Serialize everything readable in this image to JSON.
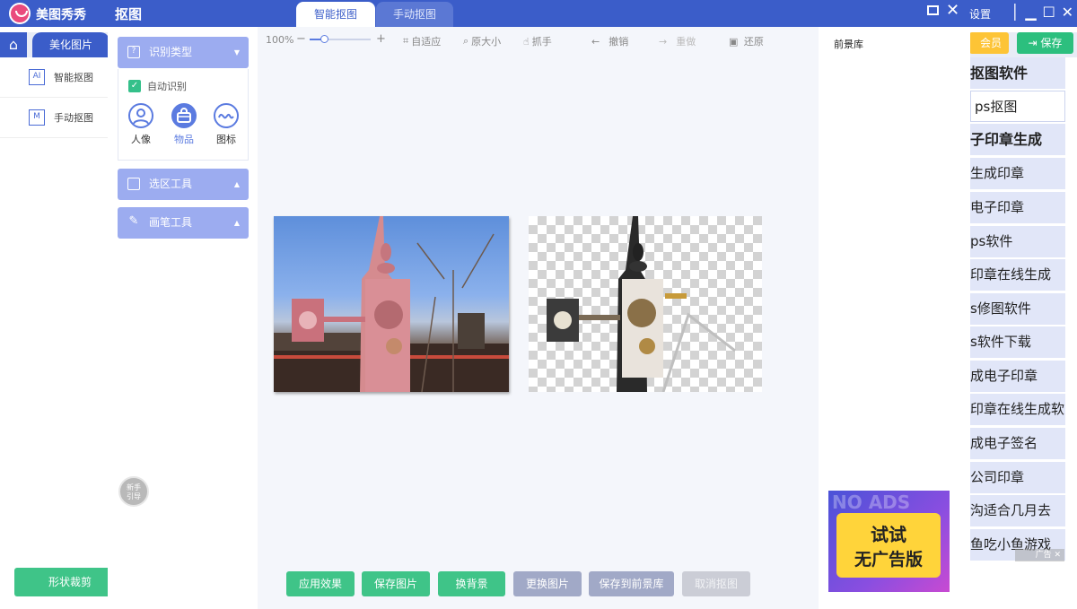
{
  "main_app": {
    "brand": "美图秀秀",
    "settings_label": "设置",
    "home_icon": "home-icon",
    "beautify_tab": "美化图片",
    "vip_label": "会员",
    "save_label": "保存",
    "left_items": [
      {
        "label": "智能抠图",
        "icon": "ai-icon",
        "icon_text": "AI"
      },
      {
        "label": "手动抠图",
        "icon": "manual-cutout-icon",
        "icon_text": "M"
      }
    ],
    "shape_crop_label": "形状裁剪",
    "keywords": [
      "抠图软件",
      "ps抠图",
      "子印章生成",
      "生成印章",
      "电子印章",
      "ps软件",
      "印章在线生成",
      "s修图软件",
      "s软件下载",
      "成电子印章",
      "印章在线生成软",
      "成电子签名",
      "公司印章",
      "沟适合几月去",
      "鱼吃小鱼游戏"
    ]
  },
  "window": {
    "title": "抠图",
    "tabs": [
      {
        "label": "智能抠图",
        "active": true
      },
      {
        "label": "手动抠图",
        "active": false
      }
    ]
  },
  "left_panel": {
    "recognition": {
      "title": "识别类型",
      "auto_label": "自动识别",
      "types": [
        {
          "label": "人像",
          "icon": "person-icon",
          "selected": false
        },
        {
          "label": "物品",
          "icon": "bag-icon",
          "selected": true
        },
        {
          "label": "图标",
          "icon": "logo-icon",
          "selected": false
        }
      ]
    },
    "selection_tool": "选区工具",
    "brush_tool": "画笔工具",
    "guide_line1": "新手",
    "guide_line2": "引导"
  },
  "toolbar": {
    "zoom": "100%",
    "zoom_fraction": 0.2,
    "fit_label": "自适应",
    "original_size_label": "原大小",
    "grab_label": "抓手",
    "undo_label": "撤销",
    "redo_label": "重做",
    "restore_label": "还原"
  },
  "actions": {
    "apply": "应用效果",
    "save_image": "保存图片",
    "change_bg": "换背景",
    "replace_image": "更换图片",
    "save_to_fg": "保存到前景库",
    "cancel_cutout": "取消抠图"
  },
  "right_panel": {
    "title": "前景库"
  },
  "ad": {
    "bg_text": "NO ADS",
    "line1": "试试",
    "line2": "无广告版",
    "close_label": "广告"
  },
  "colors": {
    "primary": "#3b5dc9",
    "panel": "#9cacf0",
    "green": "#3fc488",
    "vip": "#fdc436"
  }
}
